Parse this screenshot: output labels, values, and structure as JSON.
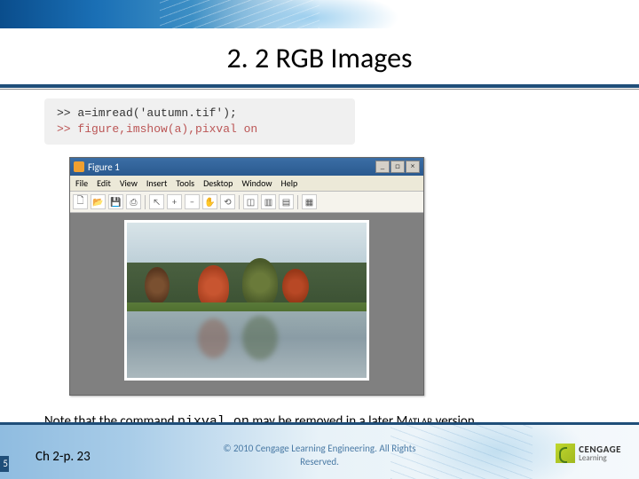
{
  "title": "2. 2 RGB Images",
  "code": {
    "line1": ">> a=imread('autumn.tif');",
    "line2": ">> figure,imshow(a),pixval on"
  },
  "figure_window": {
    "title": "Figure 1",
    "menus": [
      "File",
      "Edit",
      "View",
      "Insert",
      "Tools",
      "Desktop",
      "Window",
      "Help"
    ],
    "win_buttons": {
      "min": "_",
      "max": "□",
      "close": "×"
    },
    "toolbar_icons": [
      {
        "name": "new-icon",
        "glyph": "🗋"
      },
      {
        "name": "open-icon",
        "glyph": "📂"
      },
      {
        "name": "save-icon",
        "glyph": "💾"
      },
      {
        "name": "print-icon",
        "glyph": "⎙"
      },
      {
        "name": "pointer-icon",
        "glyph": "↖"
      },
      {
        "name": "zoom-in-icon",
        "glyph": "+"
      },
      {
        "name": "zoom-out-icon",
        "glyph": "−"
      },
      {
        "name": "pan-icon",
        "glyph": "✋"
      },
      {
        "name": "rotate-icon",
        "glyph": "⟲"
      },
      {
        "name": "datacursor-icon",
        "glyph": "◫"
      },
      {
        "name": "colorbar-icon",
        "glyph": "▥"
      },
      {
        "name": "legend-icon",
        "glyph": "▤"
      },
      {
        "name": "axes-icon",
        "glyph": "▦"
      }
    ]
  },
  "note": {
    "pre": "Note that the command ",
    "cmd": "pixval on",
    "mid": " may be removed in a later ",
    "app": "Matlab",
    "post": " version"
  },
  "footer": {
    "slide_badge": "5",
    "page_ref": "Ch 2-p. 23",
    "copyright": "© 2010 Cengage Learning Engineering. All Rights Reserved.",
    "logo": {
      "l1": "CENGAGE",
      "l2": "Learning"
    }
  }
}
